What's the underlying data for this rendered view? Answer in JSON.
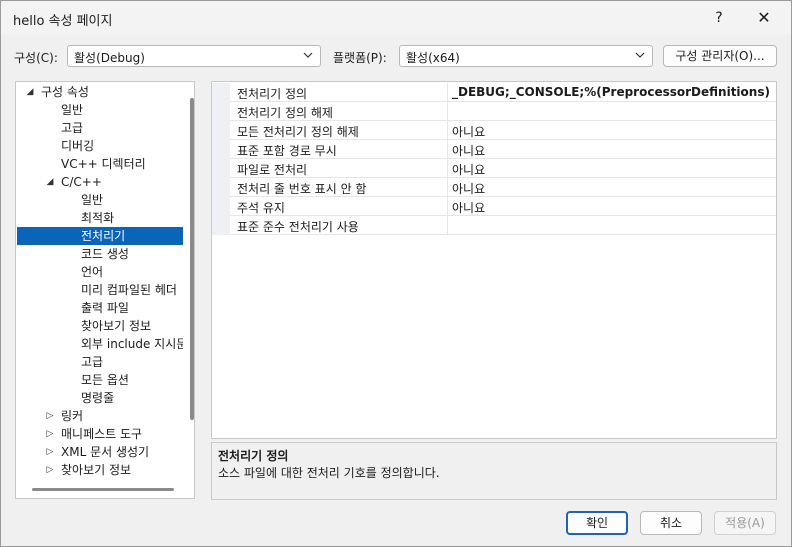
{
  "window": {
    "title": "hello 속성 페이지",
    "help_glyph": "?",
    "close_glyph": "✕"
  },
  "toolbar": {
    "configuration_label": "구성(C):",
    "configuration_value": "활성(Debug)",
    "platform_label": "플랫폼(P):",
    "platform_value": "활성(x64)",
    "config_manager_label": "구성 관리자(O)..."
  },
  "tree": {
    "items": [
      {
        "label": "구성 속성",
        "arrow": "◢",
        "level": 0
      },
      {
        "label": "일반",
        "arrow": "",
        "level": 1
      },
      {
        "label": "고급",
        "arrow": "",
        "level": 1
      },
      {
        "label": "디버깅",
        "arrow": "",
        "level": 1
      },
      {
        "label": "VC++ 디렉터리",
        "arrow": "",
        "level": 1
      },
      {
        "label": "C/C++",
        "arrow": "◢",
        "level": 1
      },
      {
        "label": "일반",
        "arrow": "",
        "level": 2
      },
      {
        "label": "최적화",
        "arrow": "",
        "level": 2
      },
      {
        "label": "전처리기",
        "arrow": "",
        "level": 2,
        "selected": true
      },
      {
        "label": "코드 생성",
        "arrow": "",
        "level": 2
      },
      {
        "label": "언어",
        "arrow": "",
        "level": 2
      },
      {
        "label": "미리 컴파일된 헤더",
        "arrow": "",
        "level": 2
      },
      {
        "label": "출력 파일",
        "arrow": "",
        "level": 2
      },
      {
        "label": "찾아보기 정보",
        "arrow": "",
        "level": 2
      },
      {
        "label": "외부 include 지시문",
        "arrow": "",
        "level": 2
      },
      {
        "label": "고급",
        "arrow": "",
        "level": 2
      },
      {
        "label": "모든 옵션",
        "arrow": "",
        "level": 2
      },
      {
        "label": "명령줄",
        "arrow": "",
        "level": 2
      },
      {
        "label": "링커",
        "arrow": "▷",
        "level": 1
      },
      {
        "label": "매니페스트 도구",
        "arrow": "▷",
        "level": 1
      },
      {
        "label": "XML 문서 생성기",
        "arrow": "▷",
        "level": 1
      },
      {
        "label": "찾아보기 정보",
        "arrow": "▷",
        "level": 1
      }
    ]
  },
  "properties": {
    "rows": [
      {
        "name": "전처리기 정의",
        "value": "_DEBUG;_CONSOLE;%(PreprocessorDefinitions)",
        "bold": true
      },
      {
        "name": "전처리기 정의 해제",
        "value": ""
      },
      {
        "name": "모든 전처리기 정의 해제",
        "value": "아니요"
      },
      {
        "name": "표준 포함 경로 무시",
        "value": "아니요"
      },
      {
        "name": "파일로 전처리",
        "value": "아니요"
      },
      {
        "name": "전처리 줄 번호 표시 안 함",
        "value": "아니요"
      },
      {
        "name": "주석 유지",
        "value": "아니요"
      },
      {
        "name": "표준 준수 전처리기 사용",
        "value": ""
      }
    ]
  },
  "description": {
    "title": "전처리기 정의",
    "text": "소스 파일에 대한 전처리 기호를 정의합니다."
  },
  "buttons": {
    "ok": "확인",
    "cancel": "취소",
    "apply": "적용(A)"
  },
  "colors": {
    "selection": "#0a64b8",
    "primary_border": "#1f62b6"
  }
}
